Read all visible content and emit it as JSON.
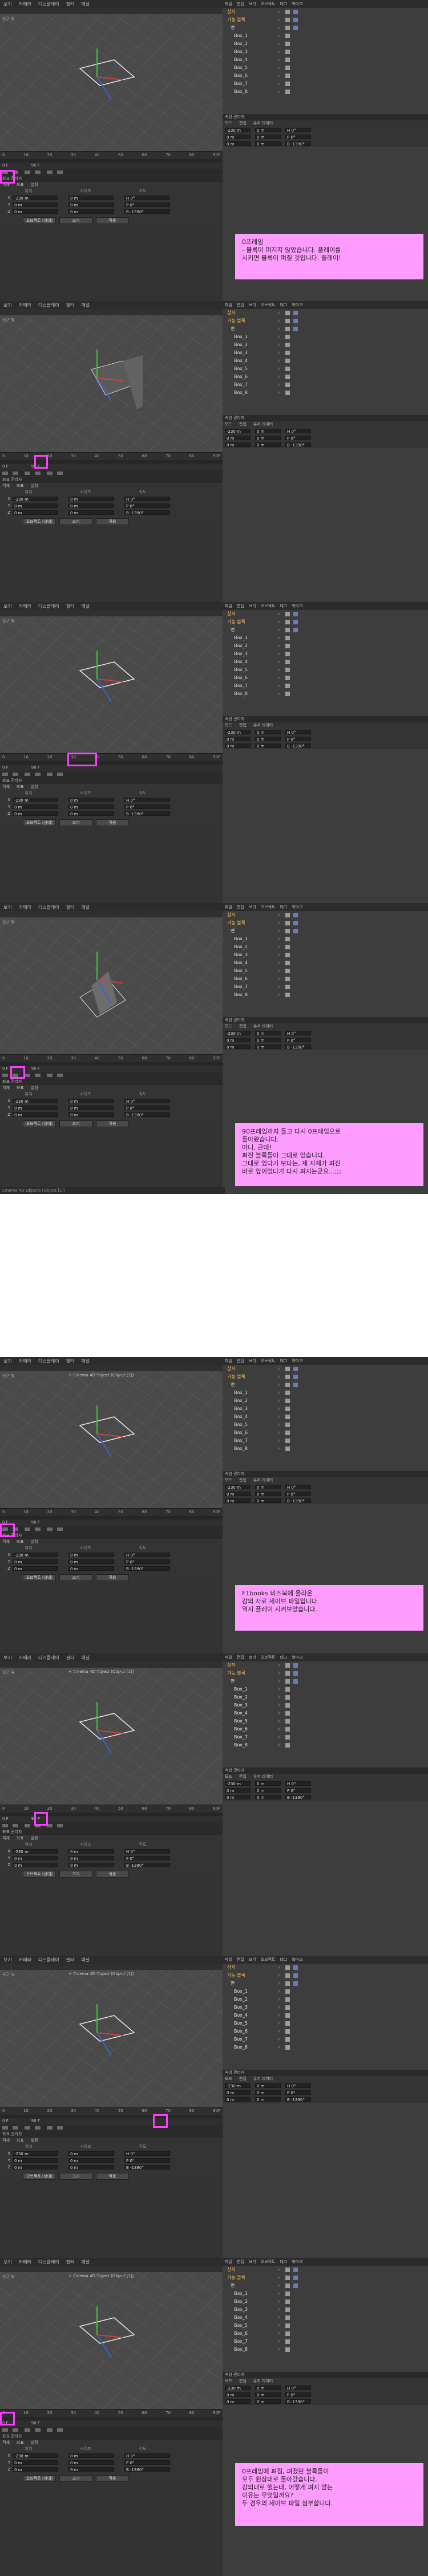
{
  "menu": [
    "보기",
    "카메라",
    "디스플레이",
    "필터",
    "패널"
  ],
  "view_label": "원근 뷰",
  "coord_label": "+ Cinema 4D Object (Object [1])",
  "timeline_ticks": [
    "0",
    "10",
    "20",
    "30",
    "40",
    "50",
    "60",
    "70",
    "80",
    "90F"
  ],
  "frame_info": [
    "0 F",
    "90 F"
  ],
  "attr": {
    "header": "좌표 관리자",
    "tabs": [
      "객체",
      "좌표",
      "설정"
    ],
    "cols": [
      "위치",
      "사이즈",
      "각도"
    ],
    "rows": [
      {
        "axis": "X",
        "pos": "-230 m",
        "size": "0 m",
        "rot": "H 0°"
      },
      {
        "axis": "Y",
        "pos": "0 m",
        "size": "0 m",
        "rot": "P 0°"
      },
      {
        "axis": "Z",
        "pos": "0 m",
        "size": "0 m",
        "rot": "B -1390°"
      }
    ],
    "btn_obj": "오브젝트 (상대)",
    "btn_size": "크기",
    "btn_apply": "적용"
  },
  "object_manager": {
    "menu": [
      "파일",
      "편집",
      "보기",
      "오브젝트",
      "태그",
      "북마크"
    ],
    "items": [
      "상자",
      "가능 블록",
      "면",
      "Box_1",
      "Box_2",
      "Box_3",
      "Box_4",
      "Box_5",
      "Box_6",
      "Box_7",
      "Box_8"
    ],
    "attr_header": "속성 관리자",
    "attr_tabs": [
      "모드",
      "편집",
      "유저 데이터"
    ]
  },
  "notes": [
    "0프레임\n- 블록이 펴지지 않았습니다. 플레이를\n  시키면 블록이 펴질 것입니다. 플레이!",
    "90프레임까지 돌고 다시 0프레임으로\n돌아왔습니다.\n아니, 근데!\n펴진 블록들이 그대로 있습니다.\n그대로 있다기 보다는, 제 자체가 펴진\n바로 앞이었다가 다시 펴지는군요...;;;",
    "F1books 비즈북에 올라온\n강의 자료 세이브 파일입니다.\n역시 플레이 시켜보았습니다.",
    "0프레임에 펴짐, 펴졌던 블록들이\n모두 원상태로 돌아갔습니다.\n강의대로 했는데, 어떻게 펴지 않는\n이유는 무엇일까요?\n두 경우의 세이브 파일 첨부합니다."
  ],
  "status": "Cinema 4D Objects (Object [1])"
}
